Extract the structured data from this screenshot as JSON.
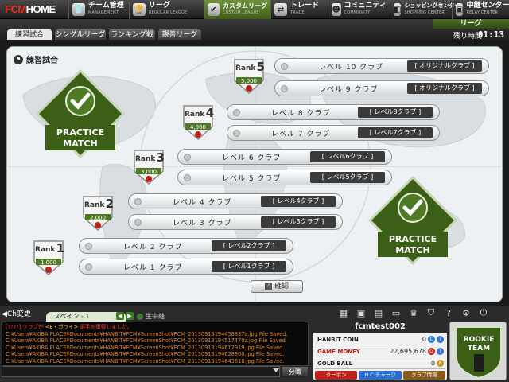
{
  "logo": {
    "prefix": "FCM",
    "suffix": "HOME"
  },
  "nav": [
    {
      "jp": "チーム管理",
      "en": "MANAGEMENT",
      "icon": "shirt-icon",
      "active": false
    },
    {
      "jp": "リーグ",
      "en": "REGULAR LEAGUE",
      "icon": "trophy-icon",
      "active": false
    },
    {
      "jp": "カスタムリーグ",
      "en": "CUSTOM LEAGUE",
      "icon": "check-icon",
      "active": true
    },
    {
      "jp": "トレード",
      "en": "TRADE",
      "icon": "trade-icon",
      "active": false
    },
    {
      "jp": "コミュニティ",
      "en": "COMMUNITY",
      "icon": "community-icon",
      "active": false
    },
    {
      "jp": "ショッピングセンター",
      "en": "SHOPPING CENTER",
      "icon": "shop-icon",
      "active": false
    },
    {
      "jp": "中継センター",
      "en": "RELAY CENTER",
      "icon": "relay-icon",
      "active": false
    }
  ],
  "subtabs": [
    "練習試合",
    "シングルリーグ",
    "ランキング戦",
    "親善リーグ"
  ],
  "league": {
    "title": "リーグ",
    "remaining_label": "残り時間",
    "timer": "01:13"
  },
  "panel": {
    "title": "練習試合",
    "confirm": "確認",
    "practice_top": "PRACTICE",
    "practice_bottom": "MATCH"
  },
  "ranks": [
    {
      "word": "Rank",
      "num": "5",
      "points": "5,000"
    },
    {
      "word": "Rank",
      "num": "4",
      "points": "4,000"
    },
    {
      "word": "Rank",
      "num": "3",
      "points": "3,000"
    },
    {
      "word": "Rank",
      "num": "2",
      "points": "2,000"
    },
    {
      "word": "Rank",
      "num": "1",
      "points": "1,000"
    }
  ],
  "levels": [
    {
      "name": "レベル 10 クラブ",
      "club": "[ オリジナルクラブ ]"
    },
    {
      "name": "レベル 9 クラブ",
      "club": "[ オリジナルクラブ ]"
    },
    {
      "name": "レベル 8 クラブ",
      "club": "[ レベル8クラブ ]"
    },
    {
      "name": "レベル 7 クラブ",
      "club": "[ レベル7クラブ ]"
    },
    {
      "name": "レベル 6 クラブ",
      "club": "[ レベル6クラブ ]"
    },
    {
      "name": "レベル 5 クラブ",
      "club": "[ レベル5クラブ ]"
    },
    {
      "name": "レベル 4 クラブ",
      "club": "[ レベル4クラブ ]"
    },
    {
      "name": "レベル 3 クラブ",
      "club": "[ レベル3クラブ ]"
    },
    {
      "name": "レベル 2 クラブ",
      "club": "[ レベル2クラブ ]"
    },
    {
      "name": "レベル 1 クラブ",
      "club": "[ レベル1クラブ ]"
    }
  ],
  "chat": {
    "channel_btn": "Ch変更",
    "channel": "スペイン - 1",
    "live": "生中継",
    "send": "分職",
    "log": [
      {
        "pre": "[????] クラブが ",
        "hl": "<E・ガライ>",
        "post": " 選手を獲得しました。",
        "red": true
      },
      {
        "text": "C:¥Users¥AKIBA PLACE¥Documents¥HANBIT¥FCM¥ScreenShot¥FCM_20130913194458837a.jpg File Saved."
      },
      {
        "text": "C:¥Users¥AKIBA PLACE¥Documents¥HANBIT¥FCM¥ScreenShot¥FCM_20130913194517470z.jpg File Saved."
      },
      {
        "text": "C:¥Users¥AKIBA PLACE¥Documents¥HANBIT¥FCM¥ScreenShot¥FCM_20130913194617919.jpg File Saved."
      },
      {
        "text": "C:¥Users¥AKIBA PLACE¥Documents¥HANBIT¥FCM¥ScreenShot¥FCM_20130913194628800.jpg File Saved."
      },
      {
        "text": "C:¥Users¥AKIBA PLACE¥Documents¥HANBIT¥FCM¥ScreenShot¥FCM_20130913194643618.jpg File Saved."
      }
    ]
  },
  "user": {
    "name": "fcmtest002",
    "hanbit_label": "HANBIT COIN",
    "hanbit_value": "0",
    "money_label": "GAME MONEY",
    "money_value": "22,695,678",
    "gold_label": "GOLD BALL",
    "gold_value": "0",
    "btn_coupon": "クーポン",
    "btn_charge": "H.C チャージ",
    "btn_club": "クラブ情報"
  },
  "rookie": {
    "line1": "ROOKIE",
    "line2": "TEAM"
  },
  "colors": {
    "accent_green": "#4f7a25",
    "dark_green": "#3b5f17",
    "money_red": "#c0201a"
  }
}
